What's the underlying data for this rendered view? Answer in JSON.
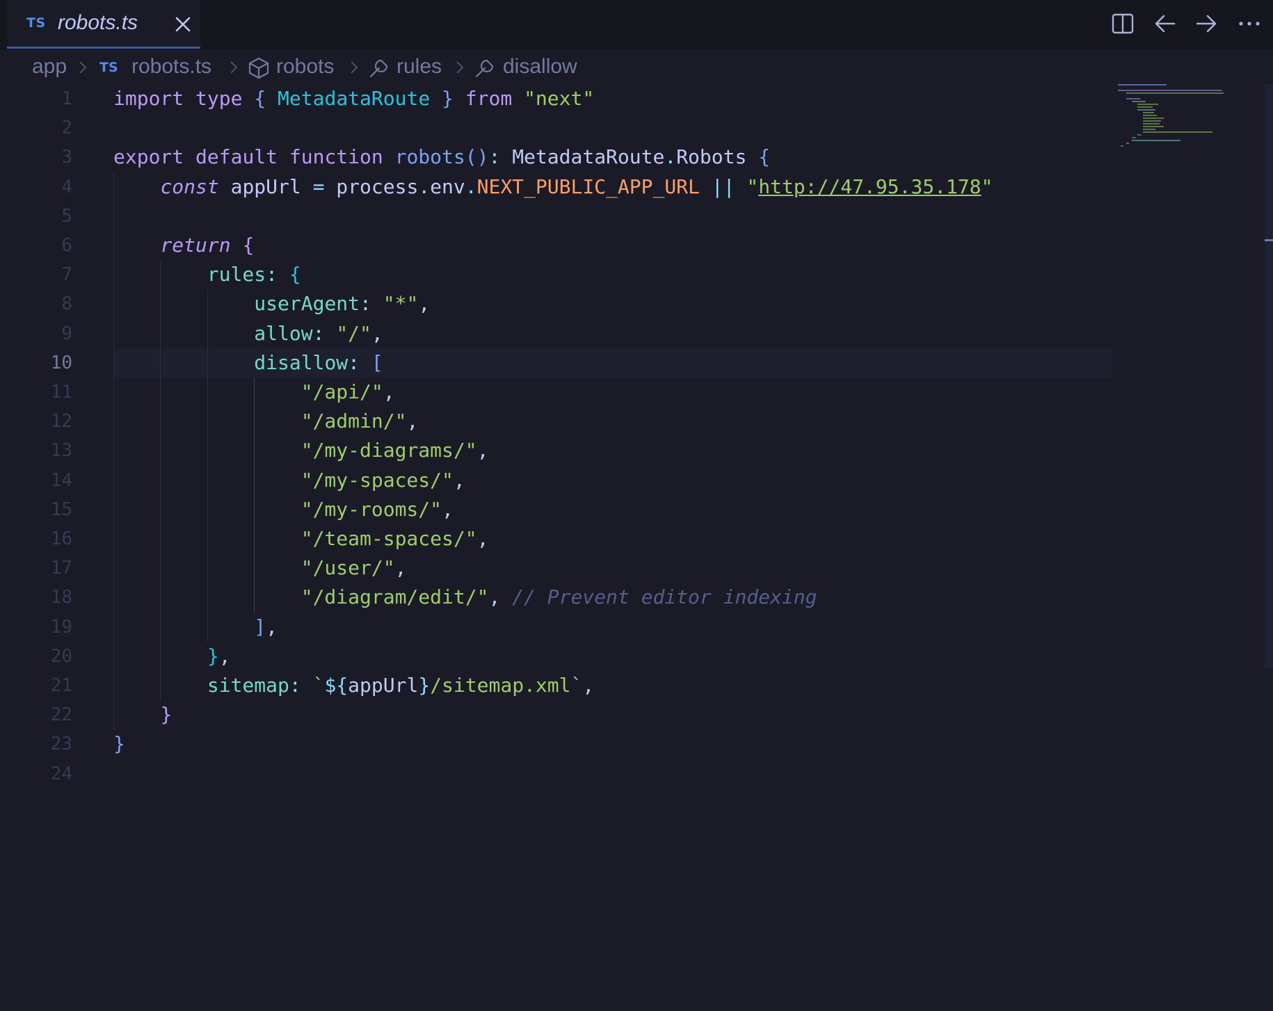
{
  "tab": {
    "lang_badge": "TS",
    "title": "robots.ts",
    "close_icon": "close-icon"
  },
  "toolbar": {
    "icons": [
      "split-editor-icon",
      "arrow-left-icon",
      "arrow-right-icon",
      "more-icon"
    ]
  },
  "breadcrumb": {
    "items": [
      {
        "label": "app"
      },
      {
        "badge": "TS",
        "label": "robots.ts"
      },
      {
        "icon": "cube-icon",
        "label": "robots"
      },
      {
        "icon": "wrench-icon",
        "label": "rules"
      },
      {
        "icon": "wrench-icon",
        "label": "disallow"
      }
    ]
  },
  "editor": {
    "active_line": 10,
    "line_numbers": [
      "1",
      "2",
      "3",
      "4",
      "5",
      "6",
      "7",
      "8",
      "9",
      "10",
      "11",
      "12",
      "13",
      "14",
      "15",
      "16",
      "17",
      "18",
      "19",
      "20",
      "21",
      "22",
      "23",
      "24"
    ],
    "lines": [
      [
        {
          "t": "import ",
          "c": "kw"
        },
        {
          "t": "type ",
          "c": "kw"
        },
        {
          "t": "{ ",
          "c": "br1"
        },
        {
          "t": "MetadataRoute",
          "c": "typ"
        },
        {
          "t": " }",
          "c": "br1"
        },
        {
          "t": " from ",
          "c": "kw"
        },
        {
          "t": "\"next\"",
          "c": "str"
        }
      ],
      [],
      [
        {
          "t": "export ",
          "c": "kw"
        },
        {
          "t": "default ",
          "c": "kw"
        },
        {
          "t": "function ",
          "c": "kw"
        },
        {
          "t": "robots",
          "c": "fn"
        },
        {
          "t": "()",
          "c": "br1"
        },
        {
          "t": ": ",
          "c": "op"
        },
        {
          "t": "MetadataRoute",
          "c": "cls"
        },
        {
          "t": ".",
          "c": "op"
        },
        {
          "t": "Robots",
          "c": "cls"
        },
        {
          "t": " {",
          "c": "br1"
        }
      ],
      [
        {
          "t": "    ",
          "c": "pl"
        },
        {
          "t": "const",
          "c": "ctl"
        },
        {
          "t": " appUrl ",
          "c": "pl"
        },
        {
          "t": "=",
          "c": "op"
        },
        {
          "t": " process",
          "c": "pl"
        },
        {
          "t": ".",
          "c": "op"
        },
        {
          "t": "env",
          "c": "pl"
        },
        {
          "t": ".",
          "c": "op"
        },
        {
          "t": "NEXT_PUBLIC_APP_URL",
          "c": "cst"
        },
        {
          "t": " ",
          "c": "pl"
        },
        {
          "t": "||",
          "c": "op"
        },
        {
          "t": " \"",
          "c": "str"
        },
        {
          "t": "http://47.95.35.178",
          "c": "link"
        },
        {
          "t": "\"",
          "c": "str"
        }
      ],
      [],
      [
        {
          "t": "    ",
          "c": "pl"
        },
        {
          "t": "return",
          "c": "ctl"
        },
        {
          "t": " {",
          "c": "br2"
        }
      ],
      [
        {
          "t": "        ",
          "c": "pl"
        },
        {
          "t": "rules",
          "c": "prop"
        },
        {
          "t": ": ",
          "c": "op"
        },
        {
          "t": "{",
          "c": "br3"
        }
      ],
      [
        {
          "t": "            ",
          "c": "pl"
        },
        {
          "t": "userAgent",
          "c": "prop"
        },
        {
          "t": ": ",
          "c": "op"
        },
        {
          "t": "\"*\"",
          "c": "str"
        },
        {
          "t": ",",
          "c": "pl"
        }
      ],
      [
        {
          "t": "            ",
          "c": "pl"
        },
        {
          "t": "allow",
          "c": "prop"
        },
        {
          "t": ": ",
          "c": "op"
        },
        {
          "t": "\"/\"",
          "c": "str"
        },
        {
          "t": ",",
          "c": "pl"
        }
      ],
      [
        {
          "t": "            ",
          "c": "pl"
        },
        {
          "t": "disallow",
          "c": "prop"
        },
        {
          "t": ": ",
          "c": "op"
        },
        {
          "t": "[",
          "c": "br1"
        }
      ],
      [
        {
          "t": "                ",
          "c": "pl"
        },
        {
          "t": "\"/api/\"",
          "c": "str"
        },
        {
          "t": ",",
          "c": "pl"
        }
      ],
      [
        {
          "t": "                ",
          "c": "pl"
        },
        {
          "t": "\"/admin/\"",
          "c": "str"
        },
        {
          "t": ",",
          "c": "pl"
        }
      ],
      [
        {
          "t": "                ",
          "c": "pl"
        },
        {
          "t": "\"/my-diagrams/\"",
          "c": "str"
        },
        {
          "t": ",",
          "c": "pl"
        }
      ],
      [
        {
          "t": "                ",
          "c": "pl"
        },
        {
          "t": "\"/my-spaces/\"",
          "c": "str"
        },
        {
          "t": ",",
          "c": "pl"
        }
      ],
      [
        {
          "t": "                ",
          "c": "pl"
        },
        {
          "t": "\"/my-rooms/\"",
          "c": "str"
        },
        {
          "t": ",",
          "c": "pl"
        }
      ],
      [
        {
          "t": "                ",
          "c": "pl"
        },
        {
          "t": "\"/team-spaces/\"",
          "c": "str"
        },
        {
          "t": ",",
          "c": "pl"
        }
      ],
      [
        {
          "t": "                ",
          "c": "pl"
        },
        {
          "t": "\"/user/\"",
          "c": "str"
        },
        {
          "t": ",",
          "c": "pl"
        }
      ],
      [
        {
          "t": "                ",
          "c": "pl"
        },
        {
          "t": "\"/diagram/edit/\"",
          "c": "str"
        },
        {
          "t": ", ",
          "c": "pl"
        },
        {
          "t": "// Prevent editor indexing",
          "c": "cmt"
        }
      ],
      [
        {
          "t": "            ",
          "c": "pl"
        },
        {
          "t": "]",
          "c": "br1"
        },
        {
          "t": ",",
          "c": "pl"
        }
      ],
      [
        {
          "t": "        ",
          "c": "pl"
        },
        {
          "t": "}",
          "c": "br3"
        },
        {
          "t": ",",
          "c": "pl"
        }
      ],
      [
        {
          "t": "        ",
          "c": "pl"
        },
        {
          "t": "sitemap",
          "c": "prop"
        },
        {
          "t": ": ",
          "c": "op"
        },
        {
          "t": "`",
          "c": "str"
        },
        {
          "t": "${",
          "c": "op"
        },
        {
          "t": "appUrl",
          "c": "pl"
        },
        {
          "t": "}",
          "c": "op"
        },
        {
          "t": "/sitemap.xml`",
          "c": "str"
        },
        {
          "t": ",",
          "c": "pl"
        }
      ],
      [
        {
          "t": "    ",
          "c": "pl"
        },
        {
          "t": "}",
          "c": "br2"
        }
      ],
      [
        {
          "t": "}",
          "c": "br1"
        }
      ],
      []
    ]
  },
  "colors": {
    "background": "#1a1b26",
    "tabbar": "#16161e",
    "accent": "#3d59a1"
  }
}
